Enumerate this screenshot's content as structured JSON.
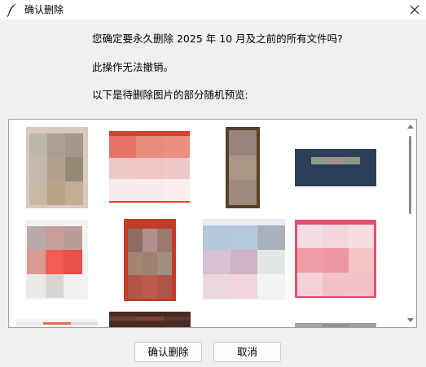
{
  "window": {
    "title": "确认删除"
  },
  "message": {
    "question": "您确定要永久删除 2025 年 10 月及之前的所有文件吗?",
    "warning": "此操作无法撤销。",
    "preview_intro": "以下是待删除图片的部分随机预览:"
  },
  "buttons": {
    "confirm": "确认删除",
    "cancel": "取消"
  },
  "preview": {
    "images": [
      {
        "name": "preview-image-1",
        "bg": "#d8c8c0",
        "cells": [
          "#bfb7ac",
          "#a99f92",
          "#a3978a",
          "#c4baab",
          "#b2a18c",
          "#958a78",
          "#c7b8a4",
          "#b9a389",
          "#c5ac95"
        ]
      },
      {
        "name": "preview-image-2",
        "bg": "#e23b34",
        "cells": [
          "#e77466",
          "#e68d7d",
          "#ea8f7d",
          "#eecac5",
          "#f0c6c2",
          "#f0c9c6",
          "#f7ebea",
          "#f8eceb",
          "#f9eeed"
        ]
      },
      {
        "name": "preview-image-3",
        "bg": "#5a3f2a",
        "cells": [
          "#95857a",
          "#a89784",
          "#9c8d7f"
        ]
      },
      {
        "name": "preview-image-4",
        "bg": "#2c3e58",
        "cells": [
          "#8a9c8a",
          "#a38f8f",
          "#8a9880"
        ]
      },
      {
        "name": "preview-image-5",
        "bg": "#f2f2f2",
        "cells": [
          "#b9aaa8",
          "#c89f98",
          "#b89c95",
          "#d99a94",
          "#f35c55",
          "#e8504c",
          "#ece9e7",
          "#d9d4d2",
          "#f0f0f0"
        ]
      },
      {
        "name": "preview-image-6",
        "bg": "#c13d2a",
        "cells": [
          "#8c6e63",
          "#b18f8a",
          "#9c786d",
          "#a28570",
          "#9e8070",
          "#a38f80",
          "#b1554a",
          "#bc5c4f",
          "#ad5648"
        ]
      },
      {
        "name": "preview-image-7",
        "bg": "#e6eef6",
        "cells": [
          "#b4c8dc",
          "#b7cadb",
          "#a8b0bb",
          "#d7c2d1",
          "#cfb4c6",
          "#e2e8e6",
          "#ebd7dd",
          "#f1d4dc",
          "#f2f4f4"
        ]
      },
      {
        "name": "preview-image-8",
        "bg": "#e0506a",
        "cells": [
          "#f2dee3",
          "#f3d5de",
          "#f6dde2",
          "#ef9ba4",
          "#ef97a0",
          "#f4c5c3",
          "#f4d1d8",
          "#f1c0c8",
          "#f2c1c8"
        ]
      },
      {
        "name": "preview-image-9",
        "bg": "#f4f4f4",
        "cells": [
          "#e8e8e8",
          "#ea6a4a",
          "#dcdcdc"
        ]
      },
      {
        "name": "preview-image-10",
        "bg": "#4a2a22",
        "cells": [
          "#6e3e32",
          "#7a4636",
          "#5e362c"
        ]
      },
      {
        "name": "preview-image-11",
        "bg": "#9a9a9a",
        "cells": [
          "#b0b0b0",
          "#8c8c8c",
          "#a4a4a4"
        ]
      }
    ]
  },
  "colors": {
    "dialog_bg": "#f0f0f0",
    "title_bg": "#ffffff",
    "preview_border": "#a0a0a0"
  },
  "icons": {
    "app": "feather-icon",
    "close": "close-icon"
  }
}
